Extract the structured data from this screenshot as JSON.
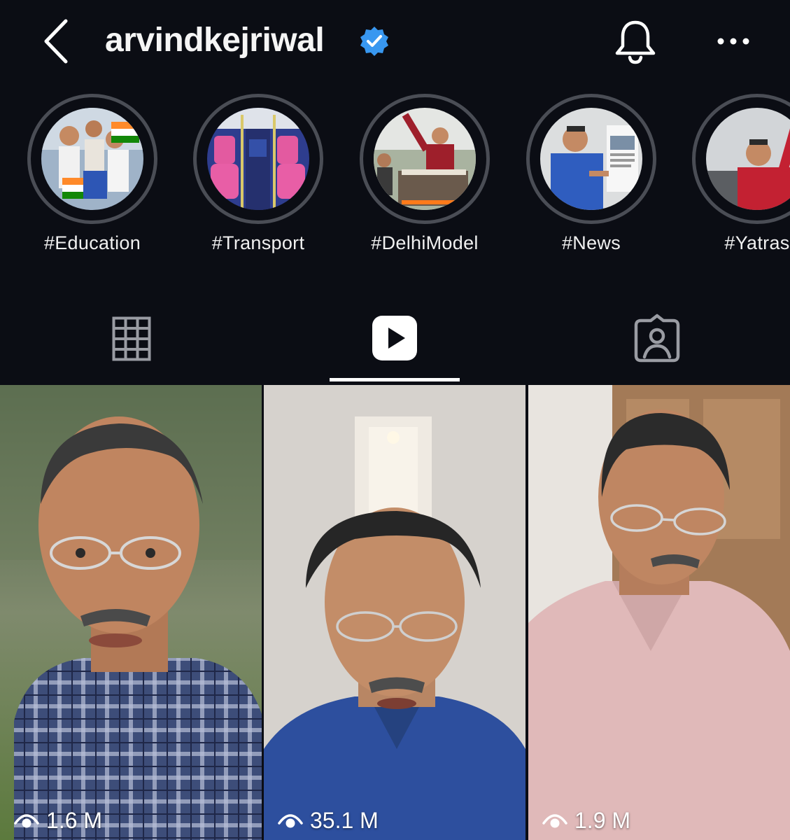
{
  "header": {
    "username": "arvindkejriwal",
    "verified": true,
    "icons": {
      "back": "chevron-left-icon",
      "verified": "verified-badge-icon",
      "notifications": "bell-icon",
      "more": "more-horizontal-icon"
    }
  },
  "highlights": [
    {
      "label": "#Education"
    },
    {
      "label": "#Transport"
    },
    {
      "label": "#DelhiModel"
    },
    {
      "label": "#News"
    },
    {
      "label": "#Yatras"
    }
  ],
  "tabs": [
    {
      "icon": "grid-icon",
      "active": false
    },
    {
      "icon": "reels-play-icon",
      "active": true
    },
    {
      "icon": "tagged-person-icon",
      "active": false
    }
  ],
  "reels": [
    {
      "views": "1.6 M"
    },
    {
      "views": "35.1 M"
    },
    {
      "views": "1.9 M"
    }
  ],
  "colors": {
    "background": "#0b0d14",
    "verified": "#3897f0",
    "ring": "#4a4d55"
  }
}
